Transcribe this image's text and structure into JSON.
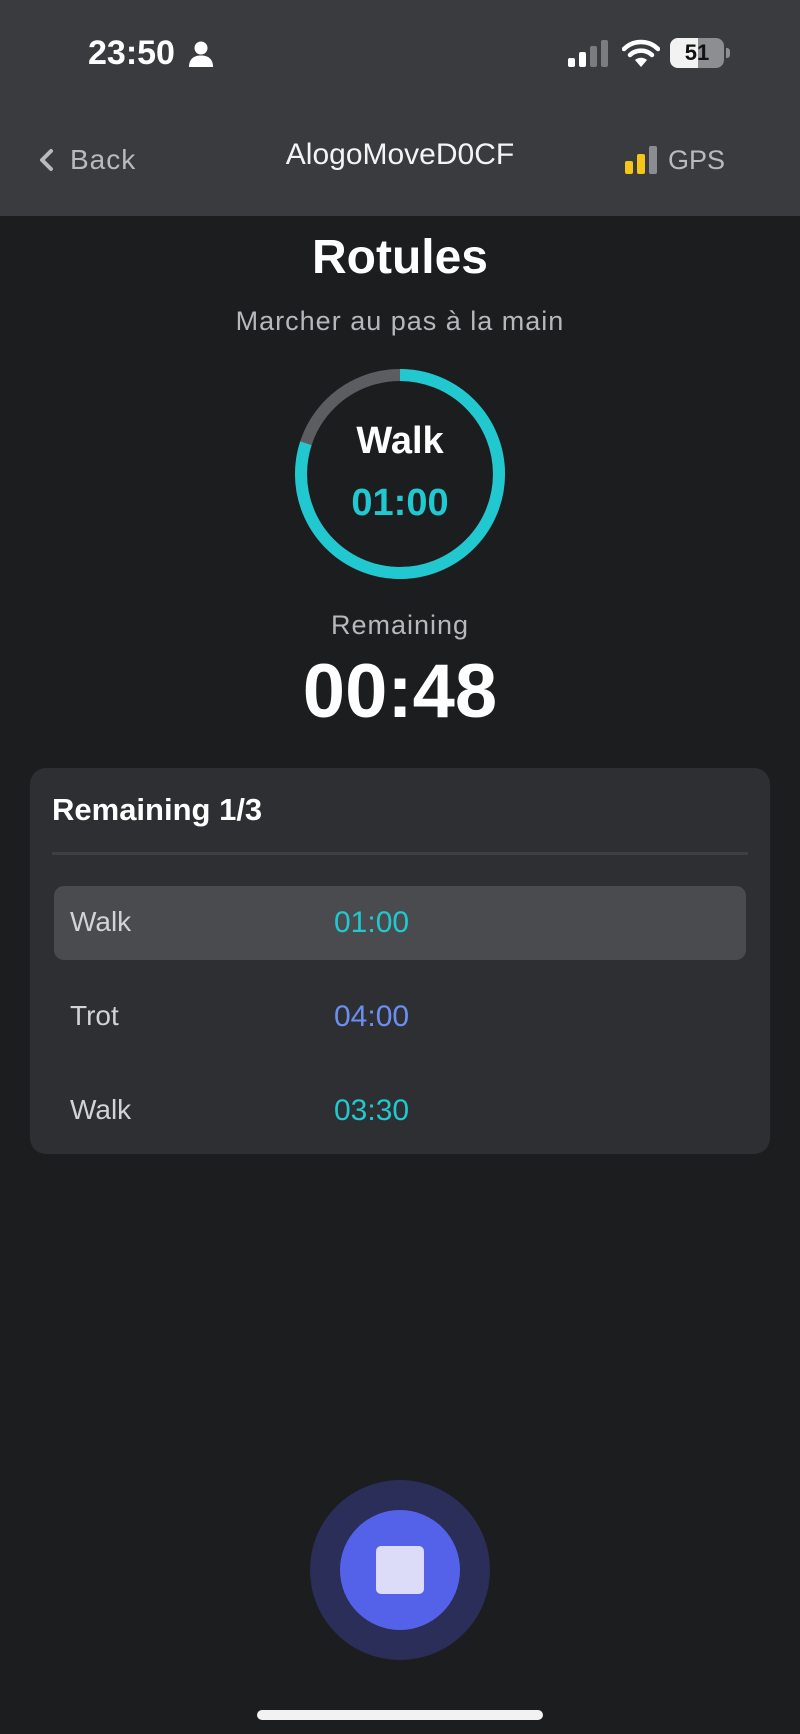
{
  "status_bar": {
    "time": "23:50",
    "battery_level": "51",
    "battery_fraction": 0.51
  },
  "nav": {
    "back_label": "Back",
    "title": "AlogoMoveD0CF",
    "gps_label": "GPS",
    "gps_signal_color": "#f5c518"
  },
  "exercise": {
    "title": "Rotules",
    "subtitle": "Marcher au pas à la main",
    "current_step": "Walk",
    "current_duration": "01:00",
    "step_progress_fraction": 0.8,
    "remaining_label": "Remaining",
    "remaining_time": "00:48"
  },
  "steps_card": {
    "title": "Remaining 1/3",
    "steps": [
      {
        "name": "Walk",
        "duration": "01:00",
        "color": "#22c8cf",
        "active": true
      },
      {
        "name": "Trot",
        "duration": "04:00",
        "color": "#6c8ef0",
        "active": false
      },
      {
        "name": "Walk",
        "duration": "03:30",
        "color": "#22c8cf",
        "active": false
      }
    ]
  },
  "colors": {
    "accent": "#22c8cf",
    "stop_button": "#5462ea",
    "background": "#1c1d1f"
  }
}
